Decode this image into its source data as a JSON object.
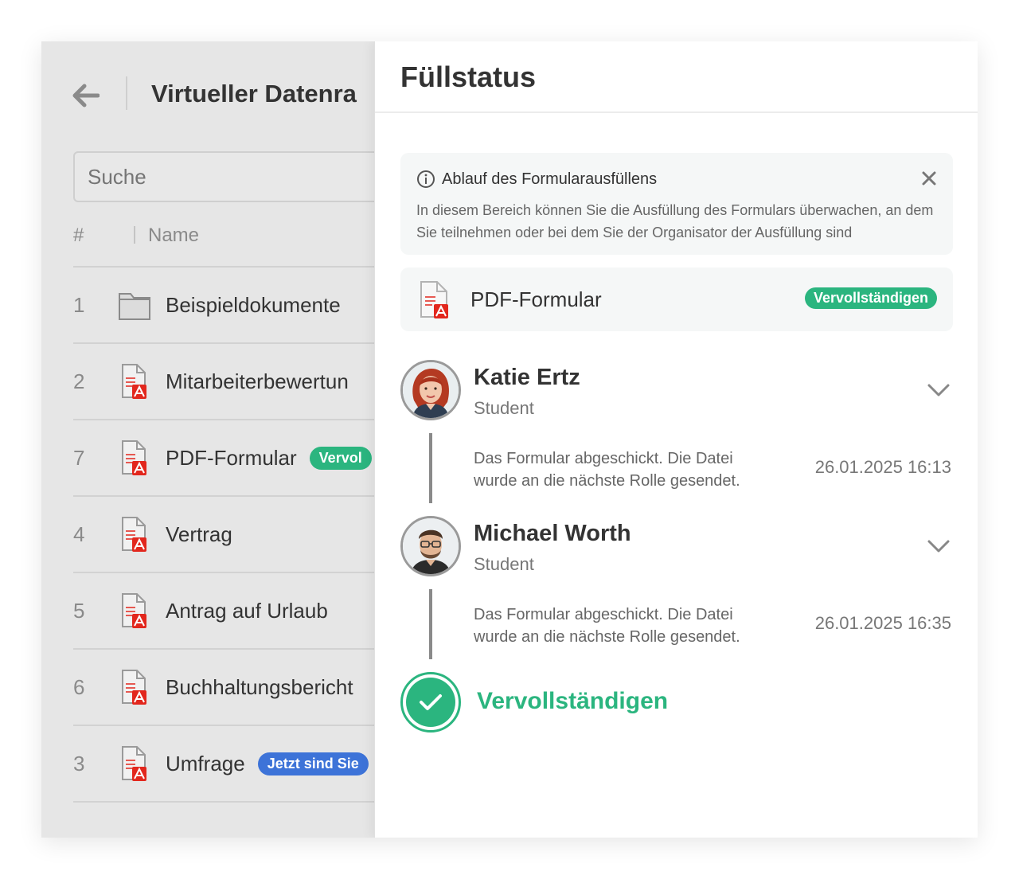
{
  "colors": {
    "accent_green": "#2bb57f",
    "badge_blue": "#3d73d8",
    "pdf_red": "#e2271d",
    "overlay_grey": "#e6e6e6"
  },
  "left_panel": {
    "back_icon": "arrow-left-icon",
    "title": "Virtueller Datenra",
    "search": {
      "placeholder": "Suche",
      "value": ""
    },
    "columns": {
      "number": "#",
      "name": "Name"
    },
    "rows": [
      {
        "num": "1",
        "icon": "folder-icon",
        "name": "Beispieldokumente",
        "badge": ""
      },
      {
        "num": "2",
        "icon": "pdf-file-icon",
        "name": "Mitarbeiterbewertun",
        "badge": ""
      },
      {
        "num": "7",
        "icon": "pdf-file-icon",
        "name": "PDF-Formular",
        "badge": "Vervol",
        "badge_color": "#2bb57f"
      },
      {
        "num": "4",
        "icon": "pdf-file-icon",
        "name": "Vertrag",
        "badge": ""
      },
      {
        "num": "5",
        "icon": "pdf-file-icon",
        "name": "Antrag auf Urlaub",
        "badge": ""
      },
      {
        "num": "6",
        "icon": "pdf-file-icon",
        "name": "Buchhaltungsbericht",
        "badge": ""
      },
      {
        "num": "3",
        "icon": "pdf-file-icon",
        "name": "Umfrage",
        "badge": "Jetzt sind Sie",
        "badge_color": "#3d73d8"
      }
    ]
  },
  "drawer": {
    "title": "Füllstatus",
    "info": {
      "icon": "info-icon",
      "title": "Ablauf des Formularausfüllens",
      "text": "In diesem Bereich können Sie die Ausfüllung des Formulars überwachen, an dem Sie teilnehmen oder bei dem Sie der Organisator der Ausfüllung sind",
      "close_icon": "close-icon"
    },
    "form": {
      "icon": "pdf-file-icon",
      "name": "PDF-Formular",
      "status": "Vervollständigen"
    },
    "participants": [
      {
        "name": "Katie Ertz",
        "role": "Student",
        "avatar": "avatar-katie",
        "event": "Das Formular abgeschickt. Die Datei wurde an die nächste Rolle gesendet.",
        "date": "26.01.2025 16:13"
      },
      {
        "name": "Michael Worth",
        "role": "Student",
        "avatar": "avatar-michael",
        "event": "Das Formular abgeschickt. Die Datei wurde an die nächste Rolle gesendet.",
        "date": "26.01.2025 16:35"
      }
    ],
    "final_step": {
      "icon": "check-icon",
      "label": "Vervollständigen"
    }
  }
}
